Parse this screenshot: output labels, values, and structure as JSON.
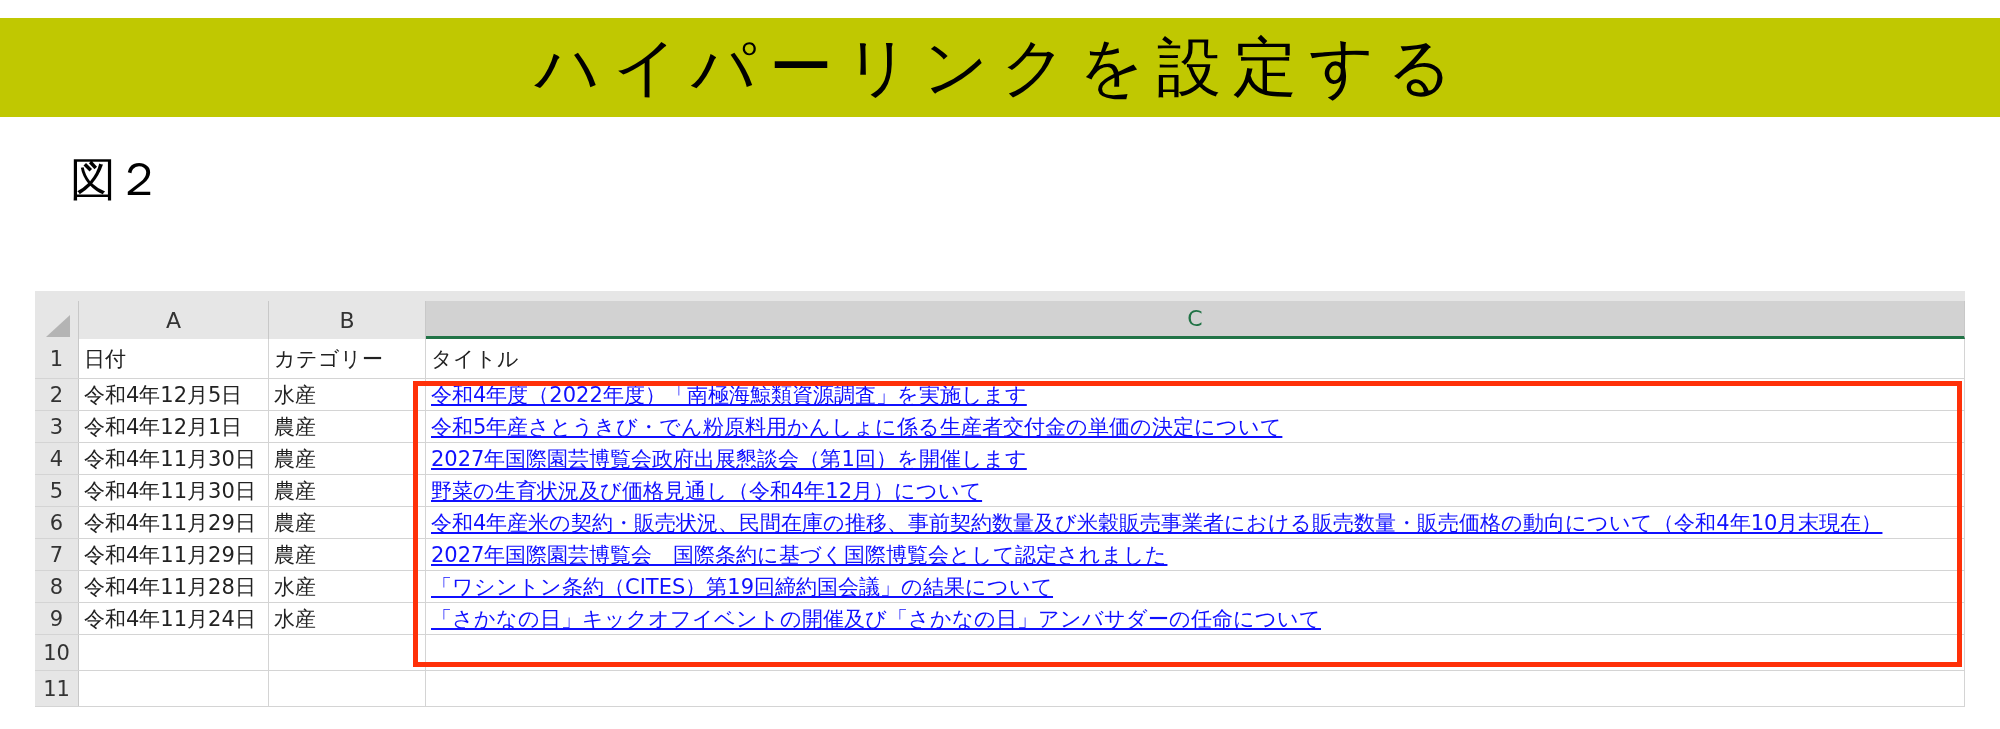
{
  "banner": {
    "title": "ハイパーリンクを設定する"
  },
  "figure_label": "図２",
  "sheet": {
    "columns": [
      {
        "label": "A",
        "selected": false
      },
      {
        "label": "B",
        "selected": false
      },
      {
        "label": "C",
        "selected": true
      }
    ],
    "rows": [
      {
        "number": "1",
        "cells": [
          {
            "kind": "text",
            "text": "日付"
          },
          {
            "kind": "text",
            "text": "カテゴリー"
          },
          {
            "kind": "text",
            "text": "タイトル"
          }
        ]
      },
      {
        "number": "2",
        "cells": [
          {
            "kind": "text",
            "text": "令和4年12月5日"
          },
          {
            "kind": "text",
            "text": "水産"
          },
          {
            "kind": "link",
            "text": "令和4年度（2022年度）「南極海鯨類資源調査」を実施します"
          }
        ]
      },
      {
        "number": "3",
        "cells": [
          {
            "kind": "text",
            "text": "令和4年12月1日"
          },
          {
            "kind": "text",
            "text": "農産"
          },
          {
            "kind": "link",
            "text": "令和5年産さとうきび・でん粉原料用かんしょに係る生産者交付金の単価の決定について"
          }
        ]
      },
      {
        "number": "4",
        "cells": [
          {
            "kind": "text",
            "text": "令和4年11月30日"
          },
          {
            "kind": "text",
            "text": "農産"
          },
          {
            "kind": "link",
            "text": "2027年国際園芸博覧会政府出展懇談会（第1回）を開催します"
          }
        ]
      },
      {
        "number": "5",
        "cells": [
          {
            "kind": "text",
            "text": "令和4年11月30日"
          },
          {
            "kind": "text",
            "text": "農産"
          },
          {
            "kind": "link",
            "text": "野菜の生育状況及び価格見通し（令和4年12月）について"
          }
        ]
      },
      {
        "number": "6",
        "cells": [
          {
            "kind": "text",
            "text": "令和4年11月29日"
          },
          {
            "kind": "text",
            "text": "農産"
          },
          {
            "kind": "link",
            "text": "令和4年産米の契約・販売状況、民間在庫の推移、事前契約数量及び米穀販売事業者における販売数量・販売価格の動向について（令和4年10月末現在）"
          }
        ]
      },
      {
        "number": "7",
        "cells": [
          {
            "kind": "text",
            "text": "令和4年11月29日"
          },
          {
            "kind": "text",
            "text": "農産"
          },
          {
            "kind": "link",
            "text": "2027年国際園芸博覧会　国際条約に基づく国際博覧会として認定されました"
          }
        ]
      },
      {
        "number": "8",
        "cells": [
          {
            "kind": "text",
            "text": "令和4年11月28日"
          },
          {
            "kind": "text",
            "text": "水産"
          },
          {
            "kind": "link",
            "text": "「ワシントン条約（CITES）第19回締約国会議」の結果について"
          }
        ]
      },
      {
        "number": "9",
        "cells": [
          {
            "kind": "text",
            "text": "令和4年11月24日"
          },
          {
            "kind": "text",
            "text": "水産"
          },
          {
            "kind": "link",
            "text": "「さかなの日」キックオフイベントの開催及び「さかなの日」アンバサダーの任命について"
          }
        ]
      },
      {
        "number": "10",
        "cells": []
      },
      {
        "number": "11",
        "cells": []
      }
    ]
  }
}
